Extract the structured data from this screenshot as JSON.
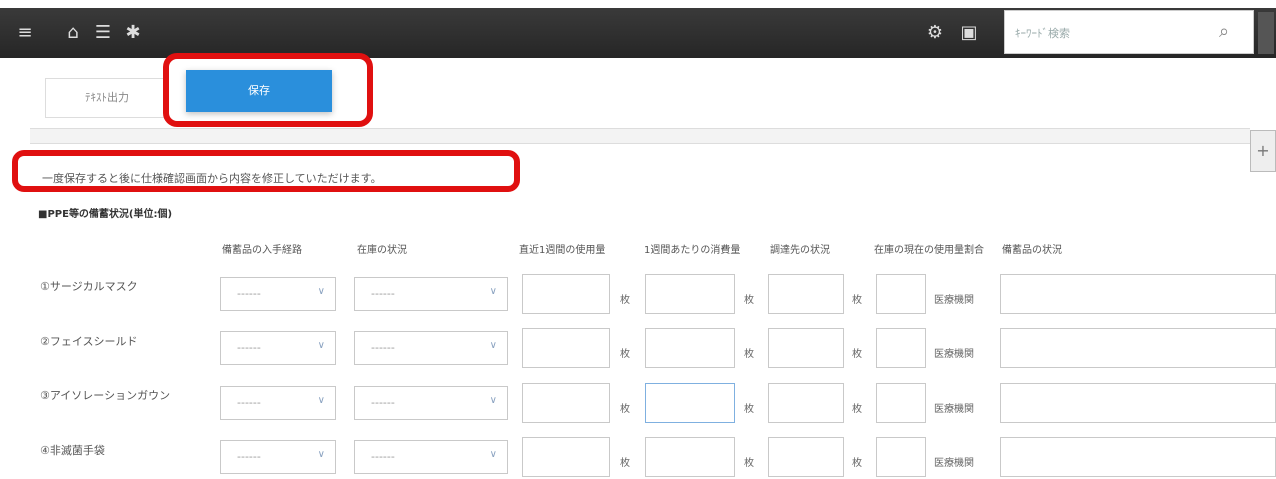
{
  "header": {
    "icons": [
      "menu-icon",
      "home-icon",
      "list-icon",
      "star-icon",
      "settings-icon",
      "window-icon",
      "search-icon"
    ],
    "search_placeholder": "ｷｰﾜｰﾄﾞ検索"
  },
  "buttons": {
    "left_label": "ﾃｷｽﾄ出力",
    "primary_label": "保存"
  },
  "notice": "一度保存すると後に仕様確認画面から内容を修正していただけます。",
  "section_title": "■PPE等の備蓄状況(単位:個)",
  "columns": [
    "備蓄品の入手経路",
    "在庫の状況",
    "直近1週間の使用量",
    "1週間あたりの消費量",
    "調達先の状況",
    "在庫の現在の使用量割合",
    "備蓄品の状況"
  ],
  "units": {
    "piece": "枚",
    "kind": "医療機関"
  },
  "rows": [
    {
      "label": "①サージカルマスク",
      "sel1": "------",
      "sel2": "------"
    },
    {
      "label": "②フェイスシールド",
      "sel1": "------",
      "sel2": "------"
    },
    {
      "label": "③アイソレーションガウン",
      "sel1": "------",
      "sel2": "------"
    },
    {
      "label": "④非滅菌手袋",
      "sel1": "------",
      "sel2": "------"
    }
  ]
}
